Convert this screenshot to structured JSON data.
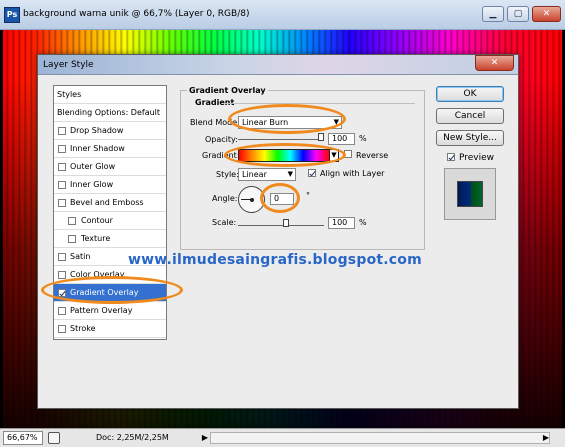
{
  "window": {
    "title": "background warna unik @ 66,7% (Layer 0, RGB/8)",
    "app_icon": "Ps",
    "minimize": "▁",
    "maximize": "▢",
    "close": "✕"
  },
  "status_bar": {
    "zoom": "66,67%",
    "doc_info": "Doc: 2,25M/2,25M"
  },
  "dialog": {
    "title": "Layer Style",
    "close": "✕",
    "styles_list": [
      {
        "label": "Styles",
        "header": true
      },
      {
        "label": "Blending Options: Default",
        "header": true
      },
      {
        "label": "Drop Shadow",
        "checked": false
      },
      {
        "label": "Inner Shadow",
        "checked": false
      },
      {
        "label": "Outer Glow",
        "checked": false
      },
      {
        "label": "Inner Glow",
        "checked": false
      },
      {
        "label": "Bevel and Emboss",
        "checked": false
      },
      {
        "label": "Contour",
        "checked": false,
        "indent": true
      },
      {
        "label": "Texture",
        "checked": false,
        "indent": true
      },
      {
        "label": "Satin",
        "checked": false
      },
      {
        "label": "Color Overlay",
        "checked": false
      },
      {
        "label": "Gradient Overlay",
        "checked": true,
        "selected": true
      },
      {
        "label": "Pattern Overlay",
        "checked": false
      },
      {
        "label": "Stroke",
        "checked": false
      }
    ],
    "section_title": "Gradient Overlay",
    "subsection_title": "Gradient",
    "blend_mode_label": "Blend Mode:",
    "blend_mode_value": "Linear Burn",
    "opacity_label": "Opacity:",
    "opacity_value": "100",
    "opacity_percent": 100,
    "percent_sign": "%",
    "gradient_label": "Gradient:",
    "reverse_label": "Reverse",
    "reverse_checked": false,
    "style_label": "Style:",
    "style_value": "Linear",
    "align_label": "Align with Layer",
    "align_checked": true,
    "angle_label": "Angle:",
    "angle_value": "0",
    "degree_sign": "°",
    "scale_label": "Scale:",
    "scale_value": "100",
    "scale_percent": 100,
    "buttons": {
      "ok": "OK",
      "cancel": "Cancel",
      "new_style": "New Style...",
      "preview": "Preview"
    },
    "preview_checked": true
  },
  "watermark": "www.ilmudesaingrafis.blogspot.com",
  "colors": {
    "annotation": "#f08a1e",
    "watermark": "#2a66c8",
    "selection": "#3470cf"
  }
}
